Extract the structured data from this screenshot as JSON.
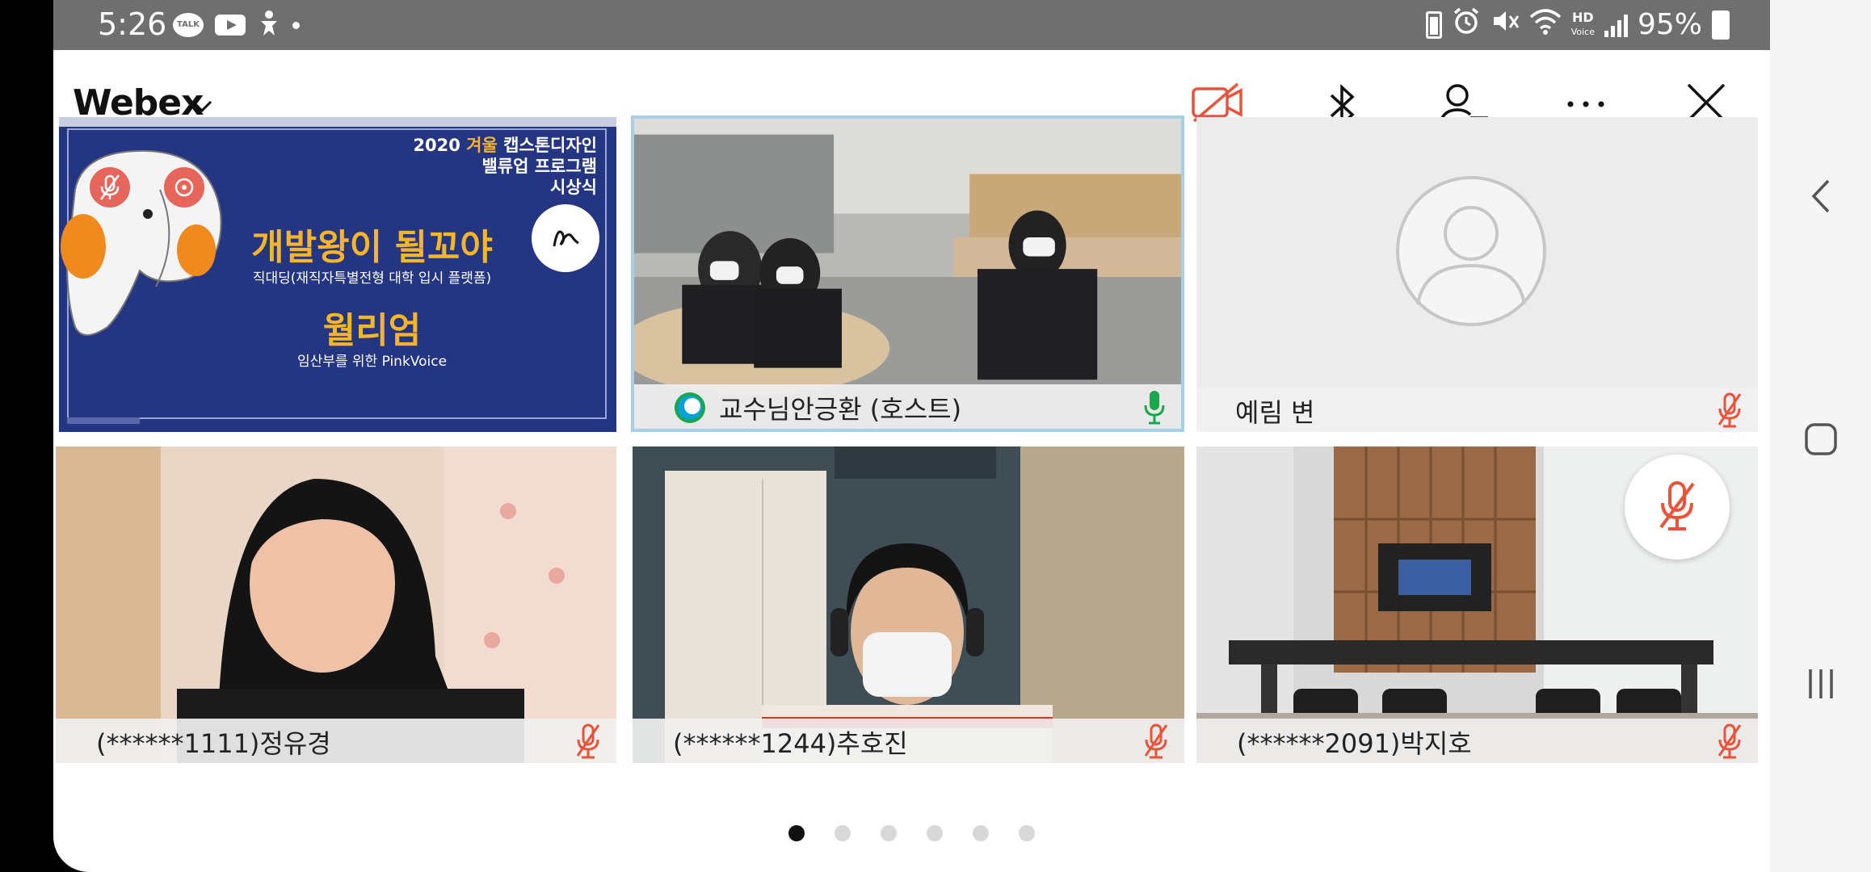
{
  "status_bar": {
    "time": "5:26",
    "app_icons": [
      "kakaotalk-icon",
      "youtube-icon",
      "accessibility-icon",
      "dot-icon"
    ],
    "hd_label": "HD",
    "voice_label": "Voice",
    "battery_percent": "95%"
  },
  "header": {
    "app_name": "Webex",
    "actions": [
      "camera-off-icon",
      "bluetooth-icon",
      "participants-icon",
      "more-icon",
      "close-icon"
    ]
  },
  "share": {
    "title_prefix": "2020 ",
    "title_highlight": "겨울",
    "title_suffix": " 캡스톤디자인",
    "line2": "밸류업 프로그램",
    "line3": "시상식",
    "award1": "개발왕이 될꼬야",
    "award1_sub": "직대딩(재직자특별전형 대학 입시 플랫폼)",
    "award2": "월리엄",
    "award2_sub": "임산부를 위한 PinkVoice"
  },
  "participants": [
    {
      "name": "교수님안긍환 (호스트)",
      "muted": false,
      "host": true
    },
    {
      "name": "예림 변",
      "muted": true
    },
    {
      "name": "(******1111)정유경",
      "muted": true
    },
    {
      "name": "(******1244)추호진",
      "muted": true
    },
    {
      "name": "(******2091)박지호",
      "muted": true
    }
  ],
  "pager": {
    "count": 6,
    "active": 0
  },
  "colors": {
    "accent": "#e8533a",
    "status_bar": "#6f6f6f",
    "mic_on": "#1aa64b",
    "slide_bg": "#243582",
    "highlight": "#f5b52b"
  }
}
